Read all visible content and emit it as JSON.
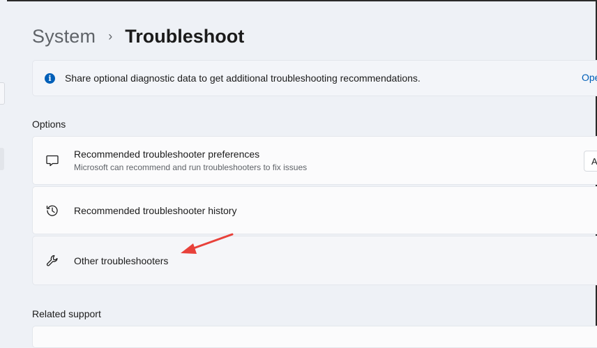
{
  "breadcrumb": {
    "parent": "System",
    "separator": "›",
    "current": "Troubleshoot"
  },
  "banner": {
    "icon": "info-icon",
    "text": "Share optional diagnostic data to get additional troubleshooting recommendations.",
    "link": "Ope"
  },
  "options": {
    "title": "Options",
    "items": [
      {
        "icon": "chat-bubble-icon",
        "title": "Recommended troubleshooter preferences",
        "subtitle": "Microsoft can recommend and run troubleshooters to fix issues",
        "control": "A"
      },
      {
        "icon": "history-icon",
        "title": "Recommended troubleshooter history"
      },
      {
        "icon": "wrench-icon",
        "title": "Other troubleshooters"
      }
    ]
  },
  "related": {
    "title": "Related support"
  },
  "colors": {
    "accent": "#005fb8",
    "annotation_arrow": "#e8413a"
  }
}
